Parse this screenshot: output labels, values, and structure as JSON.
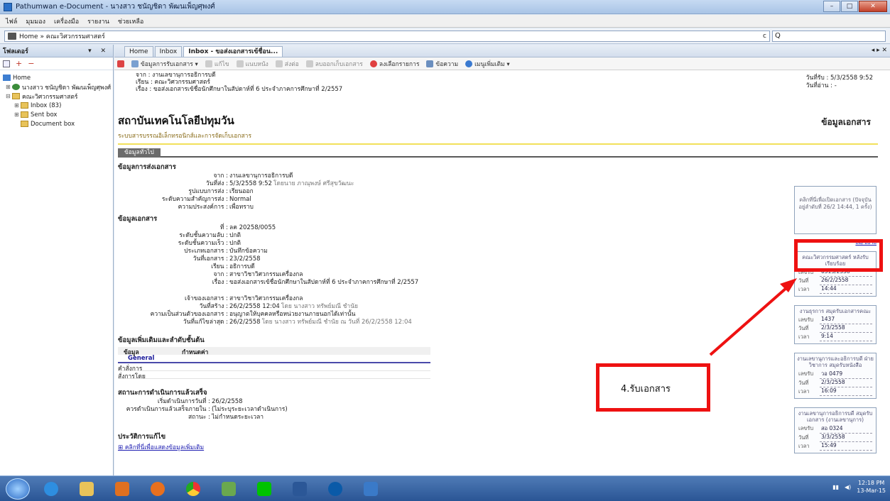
{
  "window": {
    "title": "Pathumwan e-Document - นางสาว ชนัญชิดา พัฒนเพ็ญศุพงศ์",
    "buttons": [
      "–",
      "□",
      "✕"
    ]
  },
  "menu": [
    "ไฟล์",
    "มุมมอง",
    "เครื่องมือ",
    "รายงาน",
    "ช่วยเหลือ"
  ],
  "address": {
    "path": "Home » คณะวิศวกรรมศาสตร์",
    "search_placeholder": "Q"
  },
  "left_pane": {
    "title": "โฟลเดอร์",
    "controls": "▾ ✕",
    "tool_plus": "+",
    "tool_minus": "−",
    "tree": [
      {
        "label": "Home",
        "level": 0
      },
      {
        "label": "นางสาว ชนัญชิดา พัฒนเพ็ญศุพงศ์",
        "level": 1
      },
      {
        "label": "คณะวิศวกรรมศาสตร์",
        "level": 1
      },
      {
        "label": "Inbox (83)",
        "level": 2
      },
      {
        "label": "Sent box",
        "level": 2
      },
      {
        "label": "Document box",
        "level": 2
      }
    ]
  },
  "tabs": [
    "Home",
    "Inbox",
    "Inbox - ขอส่งเอกสารเข้ชื่อน..."
  ],
  "tab_nav": "◂ ▸ ✕",
  "toolbar": [
    {
      "label": "ข้อมูลการรับเอกสาร ▾",
      "dim": false
    },
    {
      "label": "แก้ไข",
      "dim": true
    },
    {
      "label": "แนบหนัง",
      "dim": true
    },
    {
      "label": "ส่งต่อ",
      "dim": true
    },
    {
      "label": "ลบออกเก็บเอกสาร",
      "dim": true
    },
    {
      "label": "ลงเลือกรายการ",
      "dim": false
    },
    {
      "label": "ข้อความ",
      "dim": false
    },
    {
      "label": "เมนูเพิ่มเติม ▾",
      "dim": false
    }
  ],
  "header": {
    "from": "จาก : งานเลขานุการอธิการบดี",
    "to": "เรียน : คณะวิศวกรรมศาสตร์",
    "subject": "เรื่อง : ขอส่งเอกสารเข้ชื่อนักศึกษาในสัปดาห์ที่ 6 ประจำภาคการศึกษาที่ 2/2557",
    "received": "วันที่รับ : 5/3/2558 9:52",
    "read": "วันที่อ่าน : -"
  },
  "doc": {
    "institution": "สถาบันเทคโนโลยีปทุมวัน",
    "doc_info": "ข้อมูลเอกสาร",
    "subtitle": "ระบบสารบรรณอิเล็กทรอนิกส์และการจัดเก็บเอกสาร",
    "general_tab": "ข้อมูลทั่วไป",
    "send_title": "ข้อมูลการส่งเอกสาร",
    "send_fields": [
      {
        "label": "จาก : ",
        "value": "งานเลขานุการอธิการบดี"
      },
      {
        "label": "วันที่ส่ง : ",
        "value": "5/3/2558 9:52",
        "note": "โดยนาย ภาณุพงษ์ ศรีสุขวัฒนะ"
      },
      {
        "label": "รูปแบบการส่ง : ",
        "value": "เรียนออก"
      },
      {
        "label": "ระดับความสำคัญการส่ง : ",
        "value": "Normal"
      },
      {
        "label": "ความประสงค์การ : ",
        "value": "เพื่อทราบ"
      }
    ],
    "doc_title": "ข้อมูลเอกสาร",
    "doc_fields": [
      {
        "label": "ที่ : ",
        "value": "ลค 20258/0055"
      },
      {
        "label": "ระดับชั้นความลับ : ",
        "value": "ปกติ"
      },
      {
        "label": "ระดับชั้นความเร็ว : ",
        "value": "ปกติ"
      },
      {
        "label": "ประเภทเอกสาร : ",
        "value": "บันทึกข้อความ"
      },
      {
        "label": "วันที่เอกสาร : ",
        "value": "23/2/2558"
      },
      {
        "label": "เรียน : ",
        "value": "อธิการบดี"
      },
      {
        "label": "จาก : ",
        "value": "สาขาวิชาวิศวกรรมเครื่องกล"
      },
      {
        "label": "เรื่อง : ",
        "value": "ขอส่งเอกสารเข้ชื่อนักศึกษาในสัปดาห์ที่ 6 ประจำภาคการศึกษาที่ 2/2557"
      }
    ],
    "owner_fields": [
      {
        "label": "เจ้าของเอกสาร : ",
        "value": "สาขาวิชาวิศวกรรมเครื่องกล"
      },
      {
        "label": "วันที่สร้าง : ",
        "value": "26/2/2558 12:04",
        "note": "โดย นางสาว ทรัพย์มณี ชำนัย"
      },
      {
        "label": "ความเป็นส่วนตัวของเอกสาร : ",
        "value": "อนุญาตให้บุคคลหรือหน่วยงานภายนอกได้เท่านั้น"
      },
      {
        "label": "วันที่แก้ไขล่าสุด : ",
        "value": "26/2/2558",
        "note": "โดย นางสาว ทรัพย์มณี ชำนัย ณ วันที่ 26/2/2558 12:04"
      }
    ],
    "extra_title": "ข้อมูลเพิ่มเติมและลำดับชั้นต้น",
    "extra_headers": [
      "ข้อมูล",
      "กำหนดค่า"
    ],
    "extra_group": "General",
    "extra_rows": [
      "คำสั่งการ",
      "สั่งการโดย"
    ],
    "status_title": "สถานะการดำเนินการแล้วเสร็จ",
    "status_fields": [
      {
        "label": "เริ่มดำเนินการวันที่ : ",
        "value": "26/2/2558"
      },
      {
        "label": "ควรดำเนินการแล้วเสร็จภายใน : ",
        "value": "(ไม่ระบุระยะเวลาดำเนินการ)"
      },
      {
        "label": "สถานะ : ",
        "value": "ไม่กำหนดระยะเวลา"
      }
    ],
    "history_title": "ประวัติการแก้ไข",
    "history_link": "⊞ คลิกที่นี่เพื่อแสดงข้อมูลเพิ่มเติม"
  },
  "right_panel": {
    "top_box": "คลิกที่นี่เพื่อเปิดเอกสาร (ปัจจุบันอยู่ลำดับที่ 26/2 14:44, 1 ครั้ง)",
    "link": "ย่อ/ขยาย",
    "boxes": [
      {
        "caption": "คณะวิศวกรรมศาสตร์ หลังรับเรียบร้อย",
        "rows": [
          [
            "เลขรับ",
            "0513/2558"
          ],
          [
            "วันที่",
            "26/2/2558"
          ],
          [
            "เวลา",
            "14:44"
          ]
        ]
      },
      {
        "caption": "งานธุรการ สมุดรับเอกสารคณะ",
        "rows": [
          [
            "เลขรับ",
            "1437"
          ],
          [
            "วันที่",
            "2/3/2558"
          ],
          [
            "เวลา",
            "9:14"
          ]
        ]
      },
      {
        "caption": "งานเลขานุการและอธิการบดี ฝ่ายวิชาการ สมุดรับหนังสือ",
        "rows": [
          [
            "เลขรับ",
            "วอ 0479"
          ],
          [
            "วันที่",
            "2/3/2558"
          ],
          [
            "เวลา",
            "16:09"
          ]
        ]
      },
      {
        "caption": "งานเลขานุการอธิการบดี สมุดรับเอกสาร (งานเลขานุการ)",
        "rows": [
          [
            "เลขรับ",
            "สอ 0324"
          ],
          [
            "วันที่",
            "3/3/2558"
          ],
          [
            "เวลา",
            "15:49"
          ]
        ]
      }
    ]
  },
  "callout": {
    "label": "4.รับเอกสาร",
    "color": "#ee1111"
  },
  "taskbar": {
    "clock_time": "12:18 PM",
    "clock_date": "13-Mar-15",
    "apps": [
      "start",
      "ie",
      "explorer",
      "media",
      "firefox",
      "chrome",
      "photos",
      "line",
      "word",
      "hp",
      "windows"
    ]
  }
}
